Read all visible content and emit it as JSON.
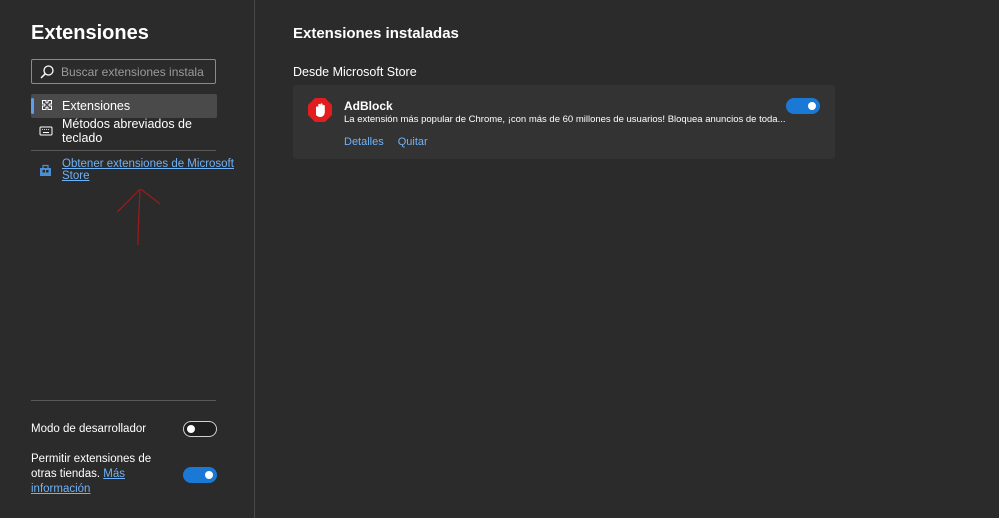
{
  "sidebar": {
    "title": "Extensiones",
    "search_placeholder": "Buscar extensiones instala",
    "nav": [
      {
        "label": "Extensiones",
        "active": true
      },
      {
        "label": "Métodos abreviados de teclado",
        "active": false
      }
    ],
    "store_link": "Obtener extensiones de Microsoft Store",
    "developer_mode": {
      "label": "Modo de desarrollador",
      "enabled": false
    },
    "other_stores": {
      "label": "Permitir extensiones de otras tiendas.",
      "link": "Más información",
      "enabled": true
    }
  },
  "main": {
    "title": "Extensiones instaladas",
    "section": "Desde Microsoft Store",
    "extensions": [
      {
        "name": "AdBlock",
        "description": "La extensión más popular de Chrome, ¡con más de 60 millones de usuarios! Bloquea anuncios de toda...",
        "details_label": "Detalles",
        "remove_label": "Quitar",
        "enabled": true,
        "icon": "adblock-hand-icon"
      }
    ]
  },
  "colors": {
    "background": "#2b2b2b",
    "card": "#333333",
    "accent": "#1a79d4",
    "link": "#6fb2f6",
    "annotation_arrow": "#9b1c1c"
  }
}
